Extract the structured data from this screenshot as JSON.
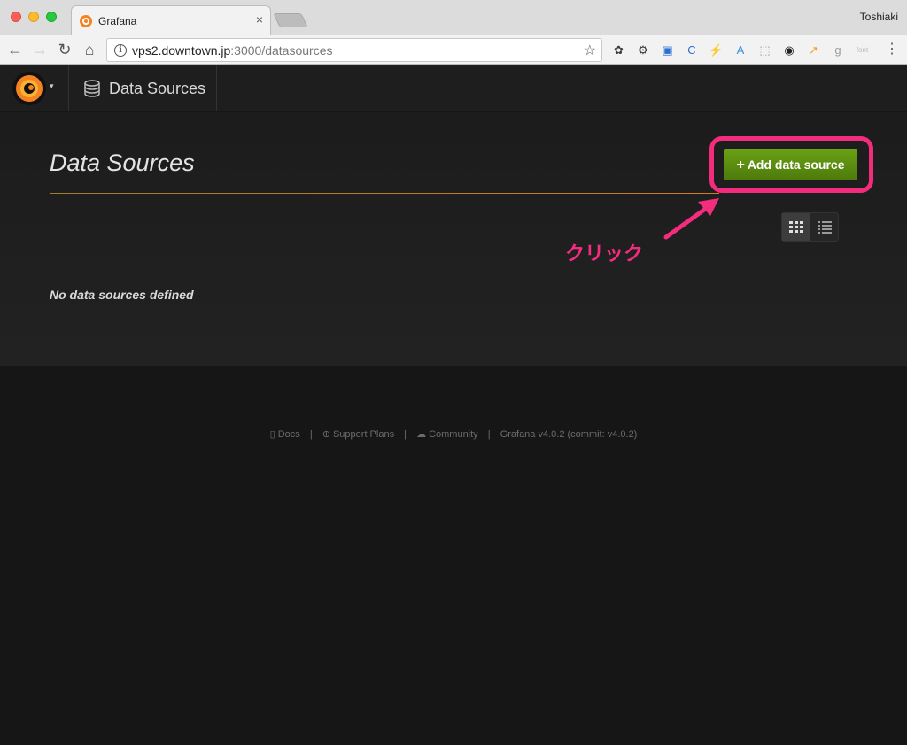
{
  "browser": {
    "tab_title": "Grafana",
    "tab_close": "×",
    "profile_name": "Toshiaki",
    "url_host": "vps2.downtown.jp",
    "url_path": ":3000/datasources",
    "back_icon": "←",
    "forward_icon": "→",
    "reload_icon": "↻",
    "home_icon": "⌂",
    "info_icon": "i",
    "star_icon": "☆",
    "menu_icon": "⋮",
    "extensions": [
      {
        "name": "evernote-icon",
        "glyph": "✿",
        "color": "#3c3c3c"
      },
      {
        "name": "settings-icon",
        "glyph": "⚙",
        "color": "#3c3c3c"
      },
      {
        "name": "screenshot-icon",
        "glyph": "▣",
        "color": "#2b6fd6"
      },
      {
        "name": "c-extension-icon",
        "glyph": "C",
        "color": "#2b6fd6"
      },
      {
        "name": "bolt-icon",
        "glyph": "⚡",
        "color": "#9e9e9e"
      },
      {
        "name": "translate-icon",
        "glyph": "A",
        "color": "#3a8de0"
      },
      {
        "name": "pdf-icon",
        "glyph": "⬚",
        "color": "#9e9e9e"
      },
      {
        "name": "camera-icon",
        "glyph": "◉",
        "color": "#222222"
      },
      {
        "name": "analytics-icon",
        "glyph": "↗",
        "color": "#f4a020"
      },
      {
        "name": "google-icon",
        "glyph": "g",
        "color": "#9e9e9e"
      },
      {
        "name": "font-icon",
        "glyph": "font",
        "color": "#bcbcbc"
      }
    ]
  },
  "grafana": {
    "nav": {
      "section_title": "Data Sources",
      "caret": "▾"
    },
    "page": {
      "title": "Data Sources",
      "add_button_plus": "+",
      "add_button_label": "Add data source",
      "empty_message": "No data sources defined"
    },
    "annotation": {
      "label": "クリック",
      "color": "#f42c7e"
    },
    "footer": {
      "docs": "Docs",
      "support": "Support Plans",
      "community": "Community",
      "version": "Grafana v4.0.2 (commit: v4.0.2)",
      "separator": "|"
    }
  },
  "colors": {
    "accent_green": "#5a8a12",
    "title_rule": "#d67a20",
    "highlight_pink": "#f42c7e",
    "background": "#161616"
  }
}
